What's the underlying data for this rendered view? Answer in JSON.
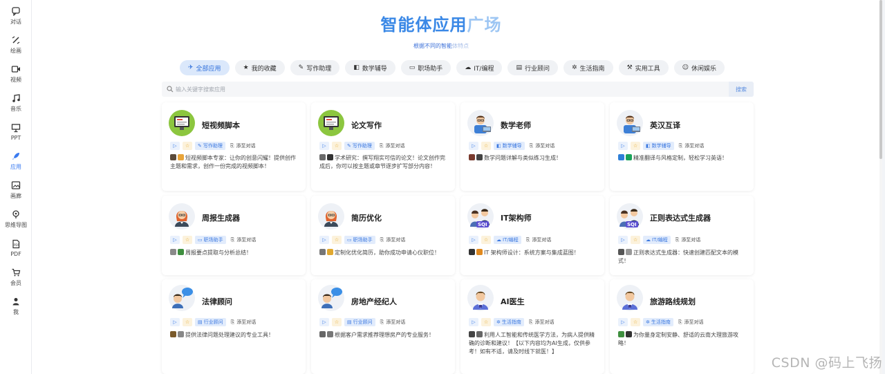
{
  "sidebar": {
    "items": [
      {
        "label": "对话",
        "icon": "chat-icon"
      },
      {
        "label": "绘画",
        "icon": "brush-icon"
      },
      {
        "label": "视频",
        "icon": "video-icon"
      },
      {
        "label": "音乐",
        "icon": "music-icon"
      },
      {
        "label": "PPT",
        "icon": "presentation-icon"
      },
      {
        "label": "应用",
        "icon": "rocket-icon"
      },
      {
        "label": "画廊",
        "icon": "gallery-icon"
      },
      {
        "label": "思维导图",
        "icon": "mindmap-icon"
      },
      {
        "label": "PDF",
        "icon": "pdf-icon"
      },
      {
        "label": "会员",
        "icon": "cart-icon"
      },
      {
        "label": "我",
        "icon": "user-icon"
      }
    ],
    "active_index": 5
  },
  "header": {
    "title_main": "智能体应用",
    "title_fade": "广场",
    "subtitle_main": "根据不同的智能",
    "subtitle_fade": "体特点"
  },
  "categories": [
    {
      "label": "全部应用",
      "icon": "✈"
    },
    {
      "label": "我的收藏",
      "icon": "★"
    },
    {
      "label": "写作助理",
      "icon": "✎"
    },
    {
      "label": "数学辅导",
      "icon": "◧"
    },
    {
      "label": "职场助手",
      "icon": "▭"
    },
    {
      "label": "IT/编程",
      "icon": "☁"
    },
    {
      "label": "行业顾问",
      "icon": "▤"
    },
    {
      "label": "生活指南",
      "icon": "✲"
    },
    {
      "label": "实用工具",
      "icon": "⚒"
    },
    {
      "label": "休闲娱乐",
      "icon": "☺"
    }
  ],
  "search": {
    "placeholder": "输入关键字搜索应用",
    "button": "搜索"
  },
  "add_label": "添至对话",
  "cards": [
    {
      "name": "短视频脚本",
      "category": "写作助理",
      "desc": "短视频脚本专家：让你的创意闪耀！提供创作主题和需求，创作一份完成的视频脚本！",
      "avatar": "screen",
      "emoji": [
        "#5b4a3a",
        "#e8a43a"
      ]
    },
    {
      "name": "论文写作",
      "category": "写作助理",
      "desc": "学术研究：撰写翔实可信的论文！论文创作完成后，你可以按主题或章节逐步扩写部分内容！",
      "avatar": "screen",
      "emoji": [
        "#6a6a6a",
        "#333333"
      ]
    },
    {
      "name": "数学老师",
      "category": "数学辅导",
      "desc": "数学问题详解与类似练习生成！",
      "avatar": "teacher",
      "emoji": [
        "#7a3b2e",
        "#444444"
      ]
    },
    {
      "name": "英汉互译",
      "category": "数学辅导",
      "desc": "精准翻译与风格定制，轻松学习英语！",
      "avatar": "teacher",
      "emoji": [
        "#2f7fd8",
        "#1aa35a"
      ]
    },
    {
      "name": "周报生成器",
      "category": "职场助手",
      "desc": "周报要点提取与分析总结！",
      "avatar": "woman",
      "emoji": [
        "#8a8a8a",
        "#3f8f3f"
      ]
    },
    {
      "name": "简历优化",
      "category": "职场助手",
      "desc": "定制化优化简历，助你成功申请心仪职位！",
      "avatar": "woman",
      "emoji": [
        "#777777",
        "#e0a830"
      ]
    },
    {
      "name": "IT架构师",
      "category": "IT/编程",
      "desc": "IT 架构师设计：系统方案与集成蓝图！",
      "avatar": "sql",
      "emoji": [
        "#333333",
        "#e08a20"
      ]
    },
    {
      "name": "正则表达式生成器",
      "category": "IT/编程",
      "desc": "正则表达式生成器：快速创建匹配文本的模式！",
      "avatar": "sql",
      "emoji": [
        "#555555",
        "#999999"
      ]
    },
    {
      "name": "法律顾问",
      "category": "行业顾问",
      "desc": "提供法律问题处理建议的专业工具！",
      "avatar": "chat",
      "emoji": [
        "#7a5a2a",
        "#888888"
      ]
    },
    {
      "name": "房地产经纪人",
      "category": "行业顾问",
      "desc": "根据客户需求推荐理想房产的专业服务！",
      "avatar": "chat",
      "emoji": [
        "#666666",
        "#777777"
      ]
    },
    {
      "name": "AI医生",
      "category": "生活指南",
      "desc": "利用人工智能和传统医学方法，为病人提供精确的诊断和建议！【以下内容均为AI生成，仅供参考！如有不适，请及时线下就医！】",
      "avatar": "doctor",
      "emoji": [
        "#444444",
        "#666666"
      ]
    },
    {
      "name": "旅游路线规划",
      "category": "生活指南",
      "desc": "为你量身定制安静、舒适的云南大理旅游攻略！",
      "avatar": "doctor",
      "emoji": [
        "#3f8f3f",
        "#333333"
      ]
    }
  ],
  "watermark": "CSDN @码上飞扬",
  "colors": {
    "accent": "#3a88e6",
    "tag_bg": "#e2ecfc",
    "tag_text": "#3b78e0",
    "star": "#e3a520"
  }
}
